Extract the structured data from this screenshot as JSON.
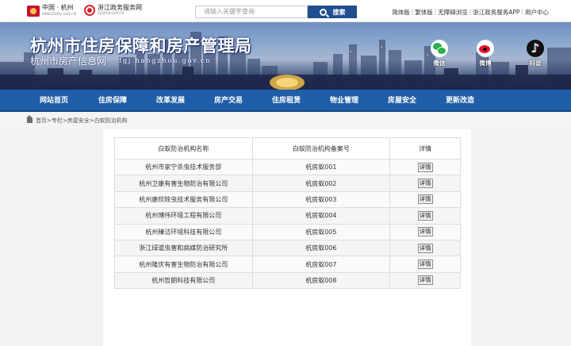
{
  "topbar": {
    "logo1_title": "中国 · 杭州",
    "logo1_sub": "HANGZHOU.GOV.CN",
    "logo2_title": "浙江政务服务网",
    "logo2_sub": "ZJZWFW.GOV.CN",
    "search_placeholder": "请输入关键字查询",
    "search_label": "搜索",
    "links": [
      "简体版",
      "繁体版",
      "无障碍浏览",
      "浙江政务服务APP",
      "用户中心"
    ]
  },
  "banner": {
    "title": "杭州市住房保障和房产管理局",
    "subtitle": "杭州市房产信息网",
    "url": "fgj.hangzhou.gov.cn",
    "social": [
      {
        "label": "微信",
        "icon": "wechat-icon"
      },
      {
        "label": "微博",
        "icon": "weibo-icon"
      },
      {
        "label": "抖音",
        "icon": "douyin-icon"
      }
    ]
  },
  "nav": {
    "items": [
      "网站首页",
      "住房保障",
      "改革发展",
      "房产交易",
      "住房租赁",
      "物业管理",
      "房屋安全",
      "更新改造"
    ]
  },
  "breadcrumb": {
    "path": "首页>专栏>房屋安全>白蚁防治机构"
  },
  "table": {
    "headers": [
      "白蚁防治机构名称",
      "白蚁防治机构备案号",
      "详情"
    ],
    "rows": [
      {
        "name": "杭州市家宁杀虫技术服务部",
        "code": "杭房蚁001",
        "detail": "详情"
      },
      {
        "name": "杭州卫康有害生物防治有限公司",
        "code": "杭房蚁002",
        "detail": "详情"
      },
      {
        "name": "杭州康欣除虫技术服务有限公司",
        "code": "杭房蚁003",
        "detail": "详情"
      },
      {
        "name": "杭州博伟环境工程有限公司",
        "code": "杭房蚁004",
        "detail": "详情"
      },
      {
        "name": "杭州臻洁环境科技有限公司",
        "code": "杭房蚁005",
        "detail": "详情"
      },
      {
        "name": "浙江绿道虫害和病媒防治研究所",
        "code": "杭房蚁006",
        "detail": "详情"
      },
      {
        "name": "杭州隆庆有害生物防治有限公司",
        "code": "杭房蚁007",
        "detail": "详情"
      },
      {
        "name": "杭州哲朗科技有限公司",
        "code": "杭房蚁008",
        "detail": "详情"
      }
    ]
  }
}
